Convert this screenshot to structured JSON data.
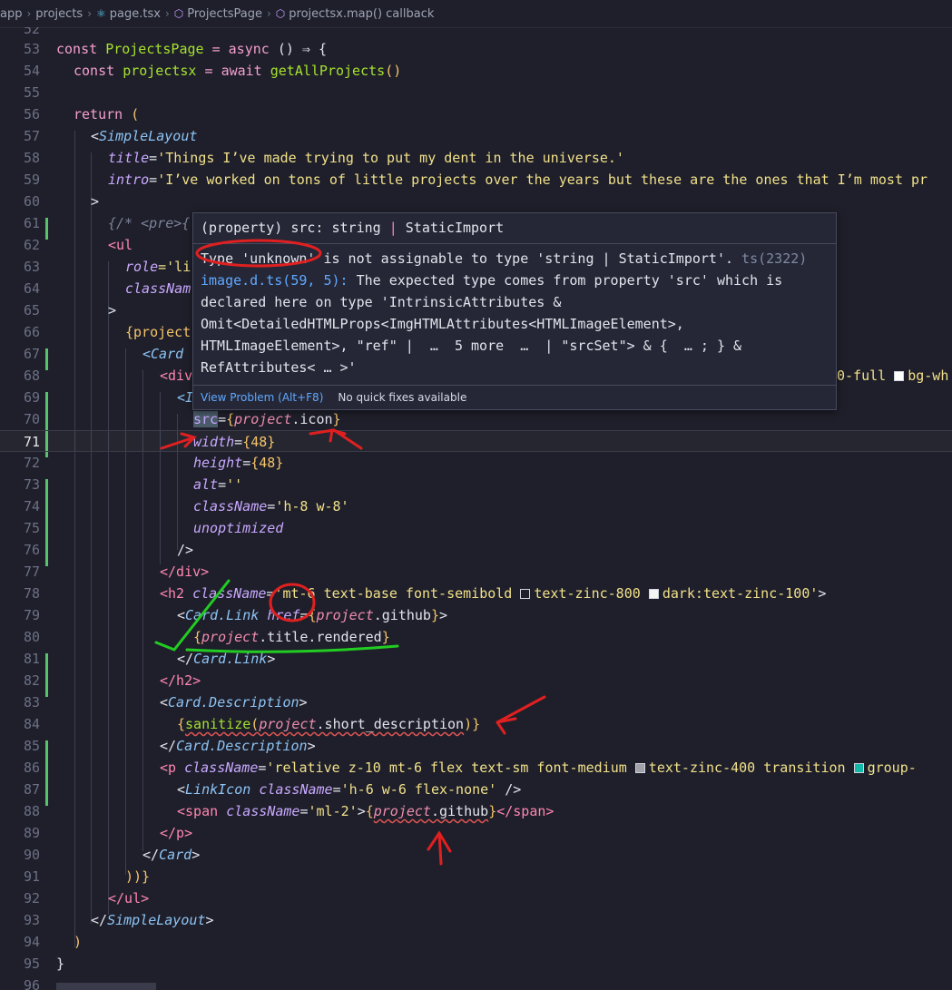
{
  "breadcrumb": {
    "items": [
      {
        "label": "app",
        "icon": ""
      },
      {
        "label": "projects",
        "icon": ""
      },
      {
        "label": "page.tsx",
        "icon": "react-icon"
      },
      {
        "label": "ProjectsPage",
        "icon": "cube-icon"
      },
      {
        "label": "projectsx.map() callback",
        "icon": "cube-icon"
      }
    ]
  },
  "editor": {
    "active_line": "71",
    "line_numbers": [
      "52",
      "53",
      "54",
      "55",
      "56",
      "57",
      "58",
      "59",
      "60",
      "61",
      "62",
      "63",
      "64",
      "65",
      "66",
      "67",
      "68",
      "69",
      "70",
      "71",
      "72",
      "73",
      "74",
      "75",
      "76",
      "77",
      "78",
      "79",
      "80",
      "81",
      "82",
      "83",
      "84",
      "85",
      "86",
      "87",
      "88",
      "89",
      "90",
      "91",
      "92",
      "93",
      "94",
      "95",
      "96"
    ],
    "code": {
      "l53_a": "const",
      "l53_b": "ProjectsPage",
      "l53_c": "=",
      "l53_d": "async",
      "l53_e": "() ⇒ {",
      "l54_a": "const",
      "l54_b": "projectsx",
      "l54_c": "=",
      "l54_d": "await",
      "l54_e": "getAllProjects",
      "l54_f": "()",
      "l56_a": "return",
      "l56_b": "(",
      "l57_a": "<",
      "l57_b": "SimpleLayout",
      "l58_a": "title",
      "l58_b": "=",
      "l58_c": "'Things I’ve made trying to put my dent in the universe.'",
      "l59_a": "intro",
      "l59_b": "=",
      "l59_c": "'I’ve worked on tons of little projects over the years but these are the ones that I’m most pr",
      "l60_a": ">",
      "l61_a": "{/* <pre>{",
      "l62_a": "<ul",
      "l63_a": "role",
      "l63_b": "='li",
      "l64_a": "classNam",
      "l65_a": ">",
      "l66_a": "{project",
      "l67_a": "<Card",
      "l68_a": "<div",
      "l68_b": "0-full",
      "l68_c": "bg-wh",
      "l69_a": "<I",
      "l70_a": "src",
      "l70_b": "=",
      "l70_c": "{",
      "l70_d": "project",
      "l70_e": ".icon",
      "l70_f": "}",
      "l71_a": "width",
      "l71_b": "=",
      "l71_c": "{48}",
      "l72_a": "height",
      "l72_b": "=",
      "l72_c": "{48}",
      "l73_a": "alt",
      "l73_b": "=",
      "l73_c": "''",
      "l74_a": "className",
      "l74_b": "=",
      "l74_c": "'h-8 w-8'",
      "l75_a": "unoptimized",
      "l76_a": "/>",
      "l77_a": "</div>",
      "l78_a": "<h2",
      "l78_b": "className",
      "l78_c": "=",
      "l78_d": "'mt-6 text-base font-semibold",
      "l78_e": "text-zinc-800",
      "l78_f": "dark:text-zinc-100'",
      "l78_g": ">",
      "l79_a": "<",
      "l79_b": "Card.Link",
      "l79_c": "href",
      "l79_d": "=",
      "l79_e": "{",
      "l79_f": "project",
      "l79_g": ".github",
      "l79_h": "}",
      "l79_i": ">",
      "l80_a": "{",
      "l80_b": "project",
      "l80_c": ".title.rendered",
      "l80_d": "}",
      "l81_a": "</",
      "l81_b": "Card.Link",
      "l81_c": ">",
      "l82_a": "</h2>",
      "l83_a": "<",
      "l83_b": "Card.Description",
      "l83_c": ">",
      "l84_a": "{",
      "l84_b": "sanitize",
      "l84_c": "(",
      "l84_d": "project",
      "l84_e": ".short_description",
      "l84_f": ")",
      "l84_g": "}",
      "l85_a": "</",
      "l85_b": "Card.Description",
      "l85_c": ">",
      "l86_a": "<p",
      "l86_b": "className",
      "l86_c": "=",
      "l86_d": "'relative z-10 mt-6 flex text-sm font-medium",
      "l86_e": "text-zinc-400 transition",
      "l86_f": "group-",
      "l87_a": "<",
      "l87_b": "LinkIcon",
      "l87_c": "className",
      "l87_d": "=",
      "l87_e": "'h-6 w-6 flex-none'",
      "l87_f": "/>",
      "l88_a": "<span",
      "l88_b": "className",
      "l88_c": "=",
      "l88_d": "'ml-2'",
      "l88_e": ">",
      "l88_f": "{",
      "l88_g": "project",
      "l88_h": ".github",
      "l88_i": "}",
      "l88_j": "</span>",
      "l89_a": "</p>",
      "l90_a": "</",
      "l90_b": "Card",
      "l90_c": ">",
      "l91_a": "))}",
      "l92_a": "</ul>",
      "l93_a": "</",
      "l93_b": "SimpleLayout",
      "l93_c": ">",
      "l94_a": ")",
      "l95_a": "}"
    }
  },
  "tooltip": {
    "prop_prefix": "(property) src: string ",
    "prop_pipe": "|",
    "prop_suffix": " StaticImport",
    "error_type": "Type ",
    "error_unknown": "'unknown'",
    "error_rest": " is not assignable to type 'string | StaticImport'.",
    "error_code": " ts(2322)",
    "file_ref": "image.d.ts(59, 5):",
    "msg_1": " The expected type comes from property 'src' which is",
    "msg_2": "declared here on type 'IntrinsicAttributes &",
    "msg_3": "Omit<DetailedHTMLProps<ImgHTMLAttributes<HTMLImageElement>,",
    "msg_4": "HTMLImageElement>, \"ref\" |  …  5 more  …  | \"srcSet\"> & {  … ; } &",
    "msg_5": "RefAttributes< … >'",
    "view_problem": "View Problem (Alt+F8)",
    "no_fixes": "No quick fixes available"
  },
  "colors": {
    "background": "#1e1f2a",
    "tooltip_bg": "#252736",
    "annotation_red": "#e02020",
    "annotation_green": "#22cc22",
    "git_added": "#57c36b"
  }
}
